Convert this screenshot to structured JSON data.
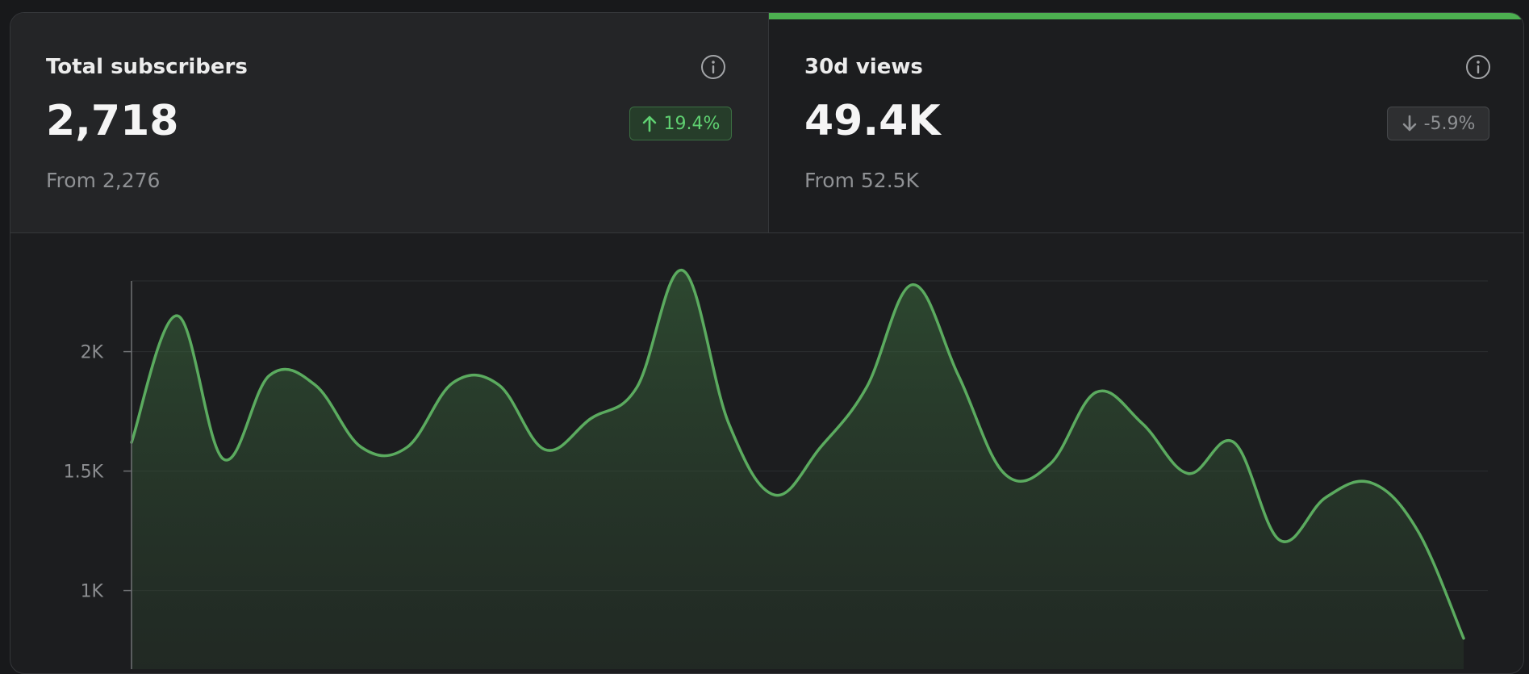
{
  "metrics": [
    {
      "title": "Total subscribers",
      "value": "2,718",
      "from": "From 2,276",
      "change": "19.4%",
      "direction": "up",
      "active": false
    },
    {
      "title": "30d views",
      "value": "49.4K",
      "from": "From 52.5K",
      "change": "-5.9%",
      "direction": "down",
      "active": true
    }
  ],
  "colors": {
    "accent": "#4caf50",
    "line": "#5bab5f",
    "badge_up_text": "#5fd071",
    "badge_down_text": "#8e9093",
    "background": "#1c1d1f"
  },
  "icons": {
    "info": "info-circle-icon",
    "up": "arrow-up-icon",
    "down": "arrow-down-icon"
  },
  "chart_data": {
    "type": "area",
    "title": "",
    "xlabel": "",
    "ylabel": "",
    "y_ticks": [
      {
        "value": 1000,
        "label": "1K"
      },
      {
        "value": 1500,
        "label": "1.5K"
      },
      {
        "value": 2000,
        "label": "2K"
      }
    ],
    "ylim": [
      850,
      2450
    ],
    "grid": true,
    "series": [
      {
        "values": [
          1620,
          2150,
          1550,
          1900,
          1860,
          1600,
          1600,
          1870,
          1860,
          1590,
          1720,
          1850,
          2340,
          1700,
          1400,
          1600,
          1850,
          2280,
          1900,
          1490,
          1530,
          1830,
          1700,
          1490,
          1620,
          1210,
          1390,
          1450,
          1250,
          800
        ]
      }
    ]
  }
}
